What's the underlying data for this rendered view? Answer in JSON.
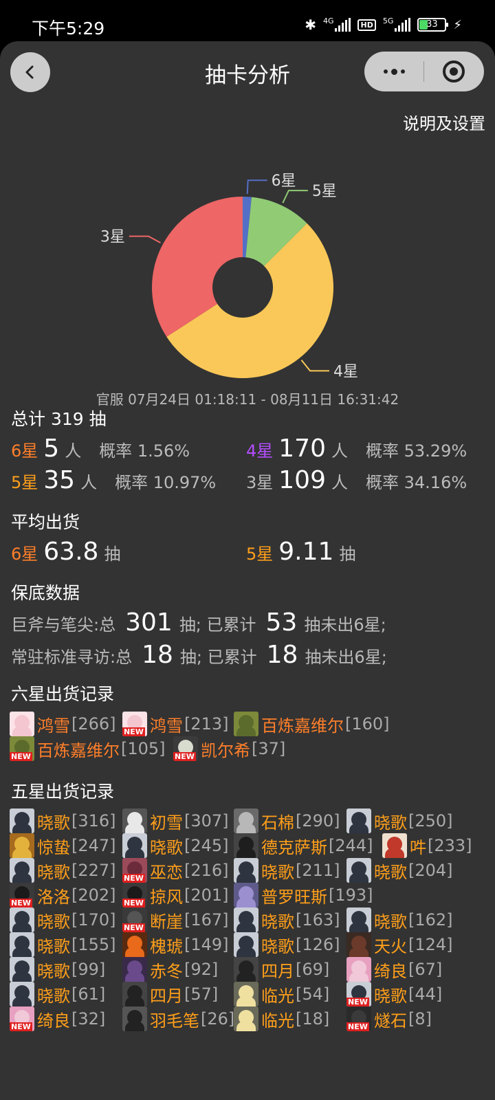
{
  "status": {
    "time": "下午5:29",
    "net1": "4G",
    "hd": "HD",
    "net2": "5G",
    "battery": "33",
    "battery_level": 0.33
  },
  "nav": {
    "title": "抽卡分析"
  },
  "settings_link": "说明及设置",
  "chart_data": {
    "type": "pie",
    "donut": true,
    "slices": [
      {
        "label": "6星",
        "value": 5,
        "color": "#5470c6"
      },
      {
        "label": "5星",
        "value": 35,
        "color": "#91cc75"
      },
      {
        "label": "4星",
        "value": 170,
        "color": "#fac858"
      },
      {
        "label": "3星",
        "value": 109,
        "color": "#ee6666"
      }
    ]
  },
  "date_range": "官服  07月24日 01:18:11  -  08月11日 16:31:42",
  "total": {
    "label": "总计 319 抽"
  },
  "rates": [
    {
      "star": "6星",
      "count": "5",
      "unit": "人",
      "prob": "概率 1.56%",
      "cls": "c6"
    },
    {
      "star": "4星",
      "count": "170",
      "unit": "人",
      "prob": "概率 53.29%",
      "cls": "c4"
    },
    {
      "star": "5星",
      "count": "35",
      "unit": "人",
      "prob": "概率 10.97%",
      "cls": "c5"
    },
    {
      "star": "3星",
      "count": "109",
      "unit": "人",
      "prob": "概率 34.16%",
      "cls": "c3"
    }
  ],
  "average": {
    "label": "平均出货",
    "items": [
      {
        "star": "6星",
        "value": "63.8",
        "unit": "抽",
        "cls": "c6"
      },
      {
        "star": "5星",
        "value": "9.11",
        "unit": "抽",
        "cls": "c5"
      }
    ]
  },
  "pity": {
    "label": "保底数据",
    "rows": [
      {
        "pool": "巨斧与笔尖:总",
        "total": "301",
        "mid": "抽;  已累计",
        "acc": "53",
        "tail": "抽未出6星;"
      },
      {
        "pool": "常驻标准寻访:总",
        "total": "18",
        "mid": "抽;  已累计",
        "acc": "18",
        "tail": "抽未出6星;"
      }
    ]
  },
  "six_star": {
    "label": "六星出货记录",
    "records": [
      {
        "name": "鸿雪",
        "pulls": "[266]",
        "new": false,
        "hair": "#f4c6cf",
        "bg": "#fbe3e8"
      },
      {
        "name": "鸿雪",
        "pulls": "[213]",
        "new": true,
        "new_label": "NEW",
        "hair": "#f4c6cf",
        "bg": "#fbe3e8"
      },
      {
        "name": "百炼嘉维尔",
        "pulls": "[160]",
        "new": false,
        "hair": "#5b6b2c",
        "bg": "#7c8a3a"
      },
      {
        "name": "百炼嘉维尔",
        "pulls": "[105]",
        "new": true,
        "new_label": "NEW",
        "hair": "#5b6b2c",
        "bg": "#7c8a3a"
      },
      {
        "name": "凯尔希",
        "pulls": "[37]",
        "new": true,
        "new_label": "NEW",
        "hair": "#d8dccf",
        "bg": "#3b3b3b"
      }
    ]
  },
  "five_star": {
    "label": "五星出货记录",
    "records": [
      {
        "name": "晓歌",
        "pulls": "[316]",
        "new": false,
        "hair": "#2e3440",
        "bg": "#c9ced6"
      },
      {
        "name": "初雪",
        "pulls": "[307]",
        "new": false,
        "hair": "#e8e8e8",
        "bg": "#555"
      },
      {
        "name": "石棉",
        "pulls": "[290]",
        "new": false,
        "hair": "#b8b8b8",
        "bg": "#6a6a6a"
      },
      {
        "name": "晓歌",
        "pulls": "[250]",
        "new": false,
        "hair": "#2e3440",
        "bg": "#c9ced6"
      },
      {
        "name": "惊蛰",
        "pulls": "[247]",
        "new": false,
        "hair": "#e3b23c",
        "bg": "#a66b1e"
      },
      {
        "name": "晓歌",
        "pulls": "[245]",
        "new": false,
        "hair": "#2e3440",
        "bg": "#c9ced6"
      },
      {
        "name": "德克萨斯",
        "pulls": "[244]",
        "new": false,
        "hair": "#1e1e1e",
        "bg": "#444"
      },
      {
        "name": "吽",
        "pulls": "[233]",
        "new": false,
        "hair": "#c0392b",
        "bg": "#f0e0d0"
      },
      {
        "name": "晓歌",
        "pulls": "[227]",
        "new": false,
        "hair": "#2e3440",
        "bg": "#c9ced6"
      },
      {
        "name": "巫恋",
        "pulls": "[216]",
        "new": true,
        "new_label": "NEW",
        "hair": "#6b2b3a",
        "bg": "#9b4a5a"
      },
      {
        "name": "晓歌",
        "pulls": "[211]",
        "new": false,
        "hair": "#2e3440",
        "bg": "#c9ced6"
      },
      {
        "name": "晓歌",
        "pulls": "[204]",
        "new": false,
        "hair": "#2e3440",
        "bg": "#c9ced6"
      },
      {
        "name": "洛洛",
        "pulls": "[202]",
        "new": true,
        "new_label": "NEW",
        "hair": "#1a1a1a",
        "bg": "#3a3a3a"
      },
      {
        "name": "掠风",
        "pulls": "[201]",
        "new": true,
        "new_label": "NEW",
        "hair": "#1a1a1a",
        "bg": "#3a3a3a"
      },
      {
        "name": "普罗旺斯",
        "pulls": "[193]",
        "new": false,
        "hair": "#9b8fd0",
        "bg": "#5e5a8a"
      },
      {
        "name": "晓歌",
        "pulls": "[170]",
        "new": false,
        "hair": "#2e3440",
        "bg": "#c9ced6"
      },
      {
        "name": "断崖",
        "pulls": "[167]",
        "new": true,
        "new_label": "NEW",
        "hair": "#555",
        "bg": "#3a3a3a"
      },
      {
        "name": "晓歌",
        "pulls": "[163]",
        "new": false,
        "hair": "#2e3440",
        "bg": "#c9ced6"
      },
      {
        "name": "晓歌",
        "pulls": "[162]",
        "new": false,
        "hair": "#2e3440",
        "bg": "#c9ced6"
      },
      {
        "name": "晓歌",
        "pulls": "[155]",
        "new": false,
        "hair": "#2e3440",
        "bg": "#c9ced6"
      },
      {
        "name": "槐琥",
        "pulls": "[149]",
        "new": false,
        "hair": "#e86a1a",
        "bg": "#5a2a10"
      },
      {
        "name": "晓歌",
        "pulls": "[126]",
        "new": false,
        "hair": "#2e3440",
        "bg": "#c9ced6"
      },
      {
        "name": "天火",
        "pulls": "[124]",
        "new": false,
        "hair": "#6b3a2a",
        "bg": "#3a2a22"
      },
      {
        "name": "晓歌",
        "pulls": "[99]",
        "new": false,
        "hair": "#2e3440",
        "bg": "#c9ced6"
      },
      {
        "name": "赤冬",
        "pulls": "[92]",
        "new": false,
        "hair": "#6a4a8a",
        "bg": "#3a2a4a"
      },
      {
        "name": "四月",
        "pulls": "[69]",
        "new": false,
        "hair": "#222",
        "bg": "#444"
      },
      {
        "name": "绮良",
        "pulls": "[67]",
        "new": false,
        "hair": "#f0c8d8",
        "bg": "#e8a0c0"
      },
      {
        "name": "晓歌",
        "pulls": "[61]",
        "new": false,
        "hair": "#2e3440",
        "bg": "#c9ced6"
      },
      {
        "name": "四月",
        "pulls": "[57]",
        "new": false,
        "hair": "#222",
        "bg": "#444"
      },
      {
        "name": "临光",
        "pulls": "[54]",
        "new": false,
        "hair": "#f0e0a0",
        "bg": "#6a6a5a"
      },
      {
        "name": "晓歌",
        "pulls": "[44]",
        "new": true,
        "new_label": "NEW",
        "hair": "#2e3440",
        "bg": "#c9ced6"
      },
      {
        "name": "绮良",
        "pulls": "[32]",
        "new": true,
        "new_label": "NEW",
        "hair": "#f0c8d8",
        "bg": "#e8a0c0"
      },
      {
        "name": "羽毛笔",
        "pulls": "[26]",
        "new": false,
        "hair": "#222",
        "bg": "#555"
      },
      {
        "name": "临光",
        "pulls": "[18]",
        "new": false,
        "hair": "#f0e0a0",
        "bg": "#6a6a5a"
      },
      {
        "name": "燧石",
        "pulls": "[8]",
        "new": true,
        "new_label": "NEW",
        "hair": "#3a3a3a",
        "bg": "#2a2a2a"
      }
    ]
  }
}
